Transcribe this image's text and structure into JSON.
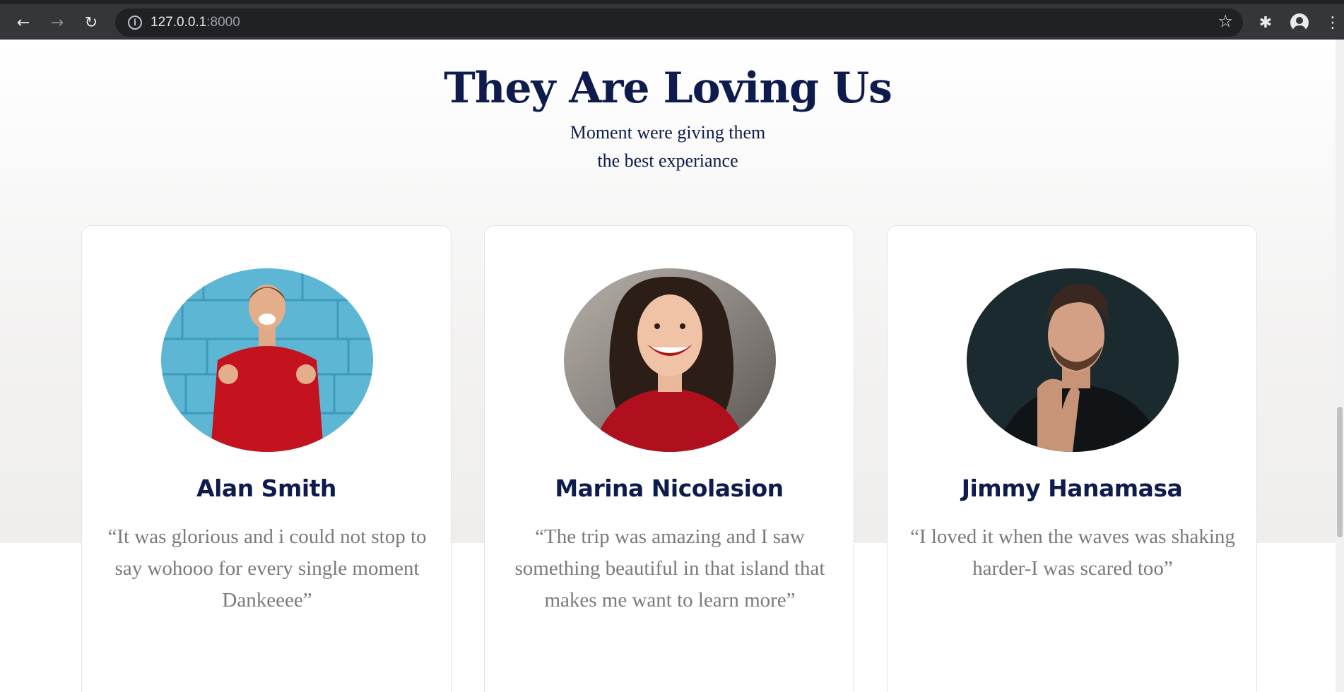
{
  "browser": {
    "url_host": "127.0.0.1",
    "url_port": ":8000",
    "icons": {
      "back": "back-arrow-icon",
      "forward": "forward-arrow-icon",
      "reload": "reload-icon",
      "info": "info-icon",
      "bookmark": "star-icon",
      "extensions": "puzzle-icon",
      "profile": "profile-icon",
      "menu": "kebab-menu-icon"
    }
  },
  "section": {
    "title": "They Are Loving Us",
    "subtitle_line1": "Moment were giving them",
    "subtitle_line2": "the best experiance"
  },
  "testimonials": [
    {
      "name": "Alan Smith",
      "quote": "“It was glorious and i could not stop to say wohooo for every single moment Dankeeee”",
      "photo": "man-red-sweater-blue-wall"
    },
    {
      "name": "Marina Nicolasion",
      "quote": "“The trip was amazing and I saw something beautiful in that island that makes me want to learn more”",
      "photo": "woman-smiling-red-top"
    },
    {
      "name": "Jimmy Hanamasa",
      "quote": "“I loved it when the waves was shaking harder-I was scared too”",
      "photo": "man-thinking-dark-background"
    }
  ],
  "colors": {
    "heading": "#0f1b4c",
    "quote_text": "#7a7a7a",
    "chrome_bg": "#35363a"
  }
}
